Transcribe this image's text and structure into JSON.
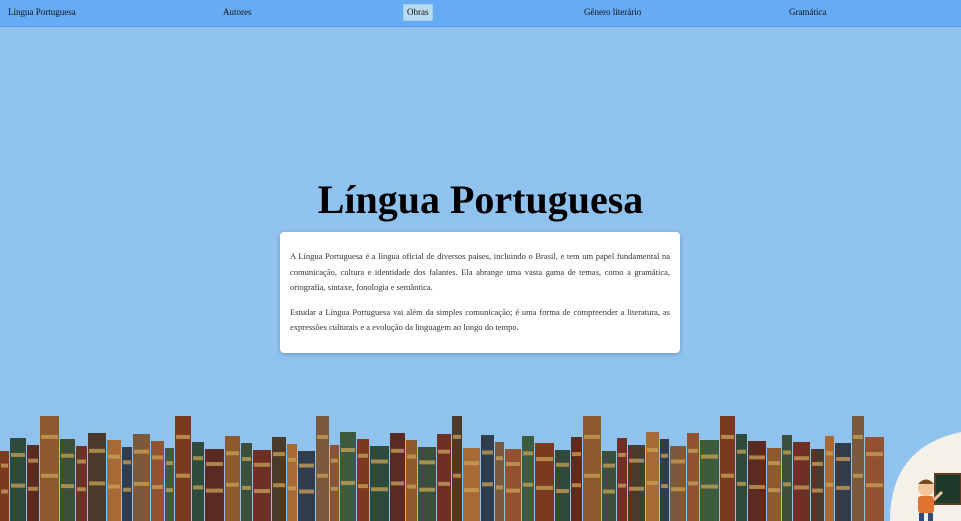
{
  "nav": {
    "items": [
      {
        "label": "Língua Portuguesa",
        "active": false
      },
      {
        "label": "Autores",
        "active": false
      },
      {
        "label": "Obras",
        "active": true
      },
      {
        "label": "Gênero literário",
        "active": false
      },
      {
        "label": "Gramática",
        "active": false
      }
    ]
  },
  "hero": {
    "title": "Língua Portuguesa"
  },
  "card": {
    "paragraph1": "A Língua Portuguesa é a língua oficial de diversos países, incluindo o Brasil, e tem um papel fundamental na comunicação, cultura e identidade dos falantes. Ela abrange uma vasta gama de temas, como a gramática, ortografia, sintaxe, fonologia e semântica.",
    "paragraph2": "Estudar a Língua Portuguesa vai além da simples comunicação; é uma forma de compreender a literatura, as expressões culturais e a evolução da linguagem ao longo do tempo."
  },
  "colors": {
    "background": "#90c2ee",
    "nav_background": "#67abf5",
    "card_background": "#ffffff"
  },
  "decoration": {
    "bookshelf": "bookshelf-illustration",
    "teacher": "teacher-illustration"
  }
}
